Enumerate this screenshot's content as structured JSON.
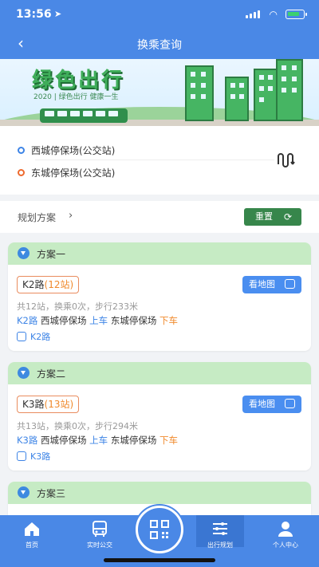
{
  "status": {
    "time": "13:56",
    "location_icon": "location-arrow-icon",
    "battery_color": "#3bd16f"
  },
  "nav": {
    "back_icon": "chevron-left-icon",
    "title": "换乘查询"
  },
  "banner": {
    "slogan": "绿色出行",
    "sub": "2020 | 绿色出行  健康一生"
  },
  "stops": {
    "from": "西城停保场(公交站)",
    "to": "东城停保场(公交站)",
    "swap_icon": "swap-route-icon"
  },
  "plan_header": {
    "label": "规划方案",
    "reset_label": "重置",
    "reset_icon": "refresh-icon"
  },
  "plans": [
    {
      "title": "方案一",
      "route": "K2路",
      "stations": "(12站)",
      "map_label": "看地图",
      "summary": "共12站，换乘0次，步行233米",
      "line": "K2路",
      "board_stop": "西城停保场",
      "board_label": "上车",
      "alight_stop": "东城停保场",
      "alight_label": "下车",
      "bus": "K2路"
    },
    {
      "title": "方案二",
      "route": "K3路",
      "stations": "(13站)",
      "map_label": "看地图",
      "summary": "共13站，换乘0次，步行294米",
      "line": "K3路",
      "board_stop": "西城停保场",
      "board_label": "上车",
      "alight_stop": "东城停保场",
      "alight_label": "下车",
      "bus": "K3路"
    },
    {
      "title": "方案三"
    }
  ],
  "tabs": [
    {
      "label": "首页",
      "icon": "home-icon"
    },
    {
      "label": "实时公交",
      "icon": "bus-icon"
    },
    {
      "label": "",
      "icon": "qr-code-icon"
    },
    {
      "label": "出行规划",
      "icon": "route-plan-icon"
    },
    {
      "label": "个人中心",
      "icon": "user-icon"
    }
  ],
  "colors": {
    "primary": "#4a88e6",
    "green": "#37864b",
    "orange": "#f08a2d",
    "card_header": "#c6ebc4"
  }
}
